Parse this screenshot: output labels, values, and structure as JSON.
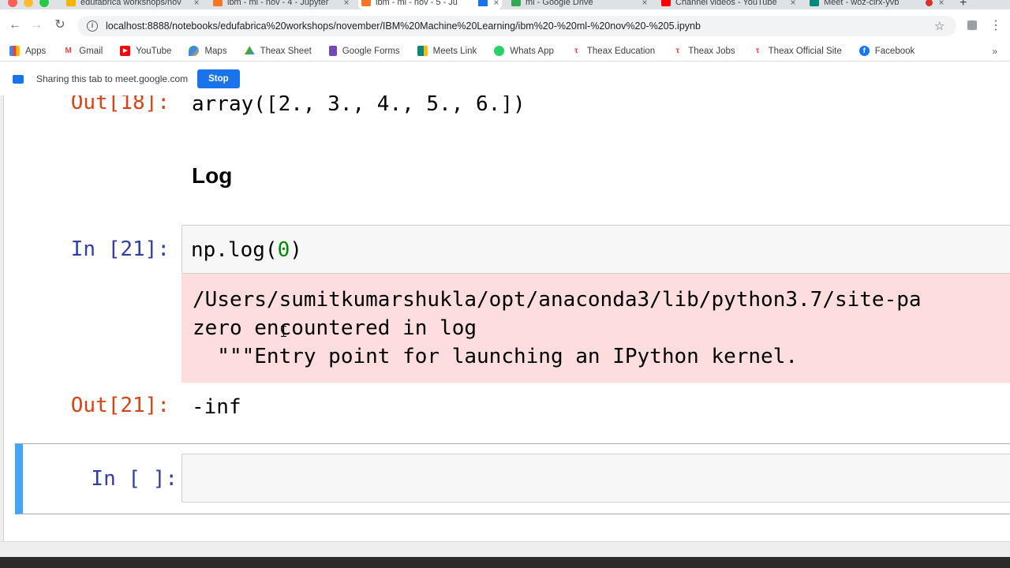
{
  "browser": {
    "tabs": [
      {
        "title": "edufabrica workshops/nov",
        "color": "#f4b400",
        "active": false
      },
      {
        "title": "ibm - ml - nov - 4 - Jupyter",
        "color": "#f37726",
        "active": false
      },
      {
        "title": "ibm - ml - nov - 5 - Ju",
        "color": "#f37726",
        "active": true
      },
      {
        "title": "ml - Google Drive",
        "color": "#34a853",
        "active": false
      },
      {
        "title": "Channel videos - YouTube",
        "color": "#ff0000",
        "active": false
      },
      {
        "title": "Meet - woz-cirx-yvb",
        "color": "#00897b",
        "active": false
      }
    ],
    "url": "localhost:8888/notebooks/edufabrica%20workshops/november/IBM%20Machine%20Learning/ibm%20-%20ml-%20nov%20-%205.ipynb",
    "bookmarks": [
      {
        "label": "Apps",
        "icon": "apps-grid-icon",
        "color": "#5f6368"
      },
      {
        "label": "Gmail",
        "icon": "gmail-icon",
        "color": "#ea4335"
      },
      {
        "label": "YouTube",
        "icon": "youtube-icon",
        "color": "#ff0000"
      },
      {
        "label": "Maps",
        "icon": "maps-icon",
        "color": "#34a853"
      },
      {
        "label": "Theax Sheet",
        "icon": "drive-icon",
        "color": "#fbbc04"
      },
      {
        "label": "Google Forms",
        "icon": "forms-icon",
        "color": "#7248b9"
      },
      {
        "label": "Meets Link",
        "icon": "meet-icon",
        "color": "#00897b"
      },
      {
        "label": "Whats App",
        "icon": "whatsapp-icon",
        "color": "#25d366"
      },
      {
        "label": "Theax Education",
        "icon": "theax-icon",
        "color": "#e53935"
      },
      {
        "label": "Theax Jobs",
        "icon": "theax-icon",
        "color": "#e53935"
      },
      {
        "label": "Theax Official Site",
        "icon": "theax-icon",
        "color": "#e53935"
      },
      {
        "label": "Facebook",
        "icon": "facebook-icon",
        "color": "#1877f2"
      }
    ]
  },
  "sharing": {
    "text": "Sharing this tab to meet.google.com",
    "stop_label": "Stop"
  },
  "notebook": {
    "out18": {
      "prompt": "Out[18]:",
      "value": "array([2., 3., 4., 5., 6.])"
    },
    "markdown_heading": "Log",
    "in21": {
      "prompt": "In [21]:",
      "code_prefix": "np.log(",
      "code_arg": "0",
      "code_suffix": ")"
    },
    "stderr": {
      "line1": "/Users/sumitkumarshukla/opt/anaconda3/lib/python3.7/site-pa",
      "line2": "zero encountered in log",
      "line3": "  \"\"\"Entry point for launching an IPython kernel."
    },
    "out21": {
      "prompt": "Out[21]:",
      "value": "-inf"
    },
    "in_empty": {
      "prompt": "In [ ]:"
    }
  },
  "colors": {
    "out_prompt": "#d84315",
    "in_prompt": "#303f9f",
    "selected_border": "#42a5f5",
    "stderr_bg": "#fddddd"
  }
}
